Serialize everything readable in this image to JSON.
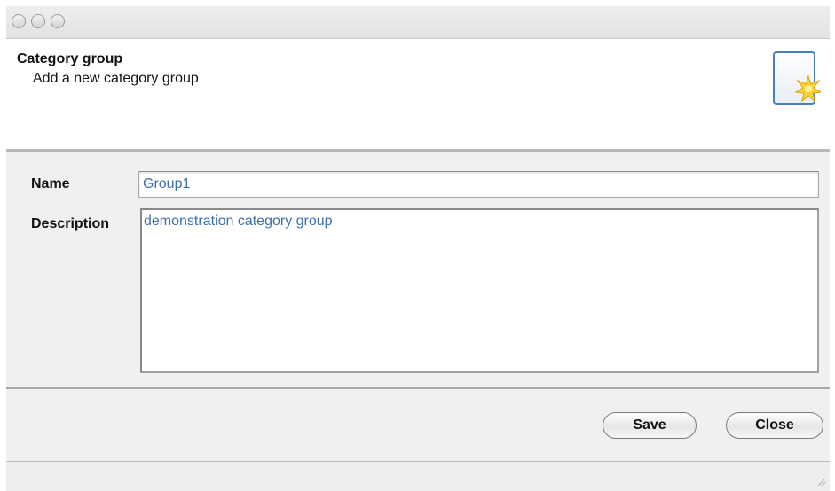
{
  "header": {
    "title": "Category group",
    "subtitle": "Add a new category group",
    "icon": "new-item-star-icon"
  },
  "form": {
    "name_label": "Name",
    "name_value": "Group1",
    "description_label": "Description",
    "description_value": "demonstration category group"
  },
  "buttons": {
    "save_label": "Save",
    "close_label": "Close"
  },
  "colors": {
    "field_text": "#3d6fa8",
    "form_background": "#f0f0f0"
  }
}
